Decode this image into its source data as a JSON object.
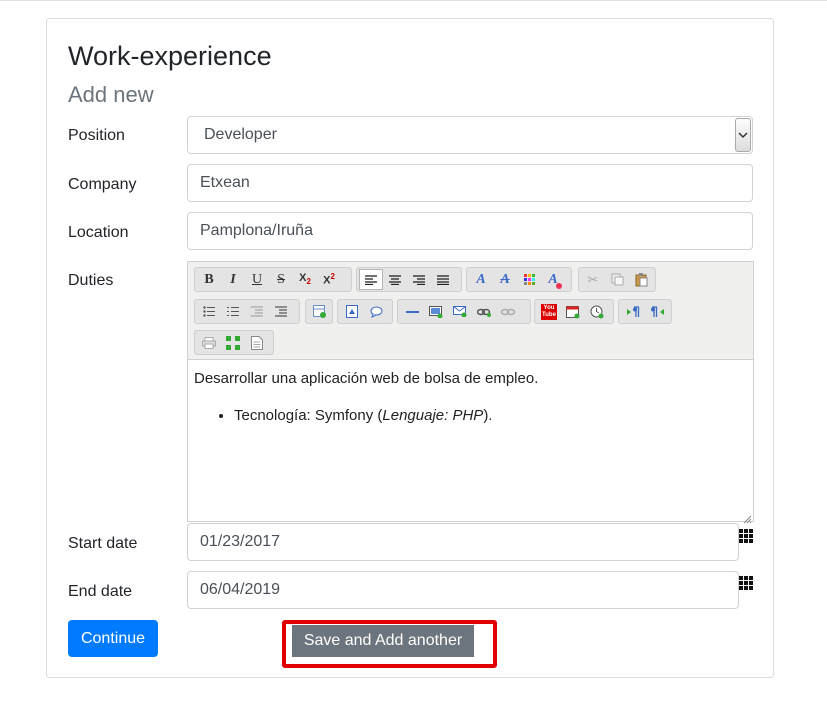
{
  "page": {
    "title": "Work-experience",
    "subtitle": "Add new"
  },
  "form": {
    "position": {
      "label": "Position",
      "value": "Developer"
    },
    "company": {
      "label": "Company",
      "value": "Etxean"
    },
    "location": {
      "label": "Location",
      "value": "Pamplona/Iruña"
    },
    "duties": {
      "label": "Duties",
      "paragraph": "Desarrollar una aplicación web de bolsa de empleo.",
      "bullet_prefix": "Tecnología: Symfony (",
      "bullet_italic": "Lenguaje: PHP",
      "bullet_suffix": ")."
    },
    "start_date": {
      "label": "Start date",
      "value": "01/23/2017"
    },
    "end_date": {
      "label": "End date",
      "value": "06/04/2019"
    }
  },
  "toolbar": {
    "bold": "B",
    "italic": "I",
    "underline": "U",
    "strike": "S",
    "subscript": "X",
    "subscript_mark": "2",
    "superscript": "X",
    "superscript_mark": "2",
    "row1_icons": [
      "bold-icon",
      "italic-icon",
      "underline-icon",
      "strikethrough-icon",
      "subscript-icon",
      "superscript-icon",
      "align-left-icon",
      "align-center-icon",
      "align-right-icon",
      "align-justify-icon",
      "font-color-icon",
      "background-color-icon",
      "color-palette-icon",
      "remove-format-icon",
      "cut-icon",
      "copy-icon",
      "paste-icon"
    ],
    "row2_icons": [
      "unordered-list-icon",
      "ordered-list-icon",
      "outdent-icon",
      "indent-icon",
      "table-icon",
      "image-icon",
      "comment-icon",
      "horizontal-rule-icon",
      "insert-media-icon",
      "email-icon",
      "link-icon",
      "unlink-icon",
      "youtube-icon",
      "insert-date-icon",
      "insert-time-icon",
      "ltr-icon",
      "rtl-icon"
    ],
    "row3_icons": [
      "print-icon",
      "fullscreen-icon",
      "source-icon"
    ],
    "youtube_text": "You Tube"
  },
  "buttons": {
    "continue": "Continue",
    "save_add_another": "Save and Add another"
  },
  "colors": {
    "primary": "#007bff",
    "secondary": "#6c757d",
    "highlight": "#e00000"
  }
}
